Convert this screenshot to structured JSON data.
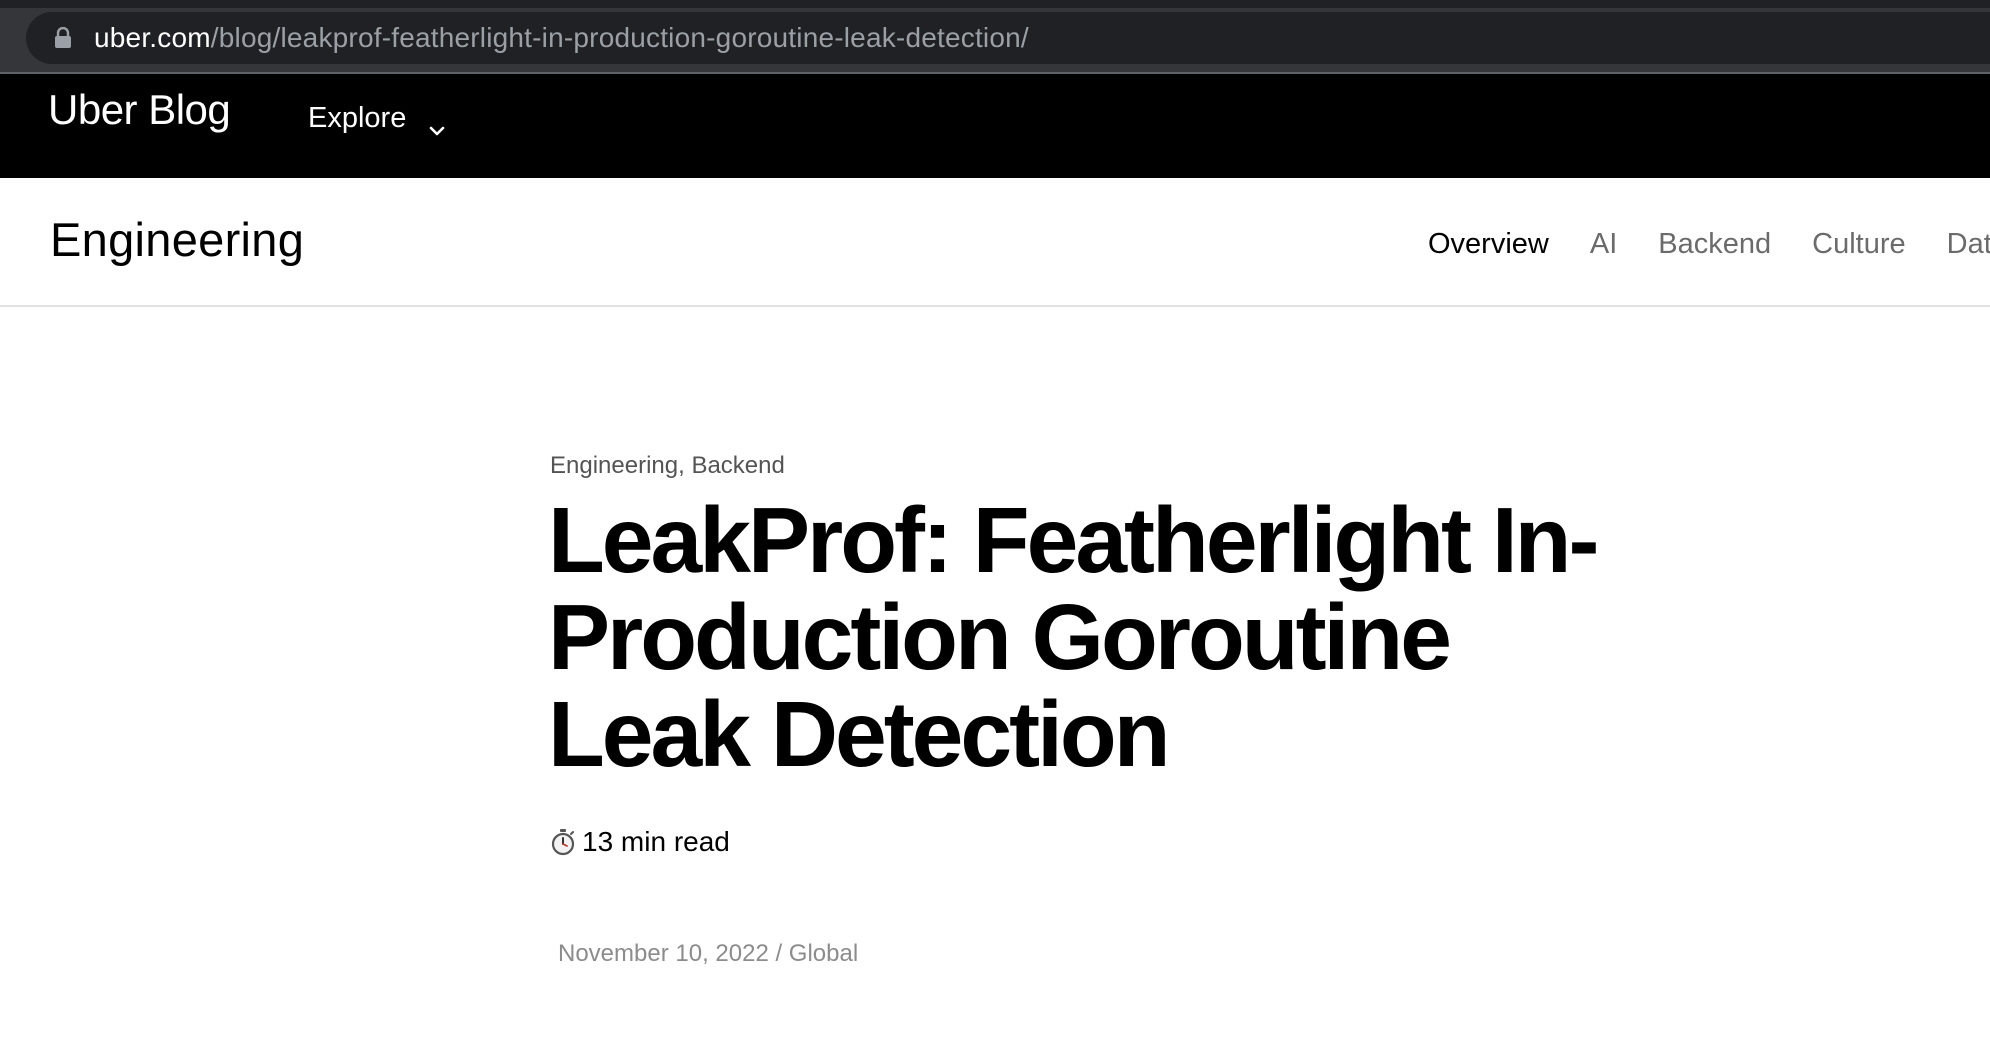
{
  "browser": {
    "url_host": "uber.com",
    "url_path": "/blog/leakprof-featherlight-in-production-goroutine-leak-detection/",
    "lock_icon": "lock-icon"
  },
  "site_header": {
    "brand": "Uber Blog",
    "explore_label": "Explore",
    "explore_icon": "chevron-down-icon",
    "background": "#000000"
  },
  "sub_header": {
    "title": "Engineering",
    "nav": [
      {
        "label": "Overview",
        "active": true
      },
      {
        "label": "AI",
        "active": false
      },
      {
        "label": "Backend",
        "active": false
      },
      {
        "label": "Culture",
        "active": false
      },
      {
        "label": "Data",
        "active": false
      }
    ]
  },
  "article": {
    "categories": [
      "Engineering",
      "Backend"
    ],
    "category_separator": ", ",
    "title": "LeakProf: Featherlight In-Production Goroutine Leak Detection",
    "read_time_icon": "stopwatch-icon",
    "read_time": "13 min read",
    "date_line": "November 10, 2022 / Global"
  }
}
